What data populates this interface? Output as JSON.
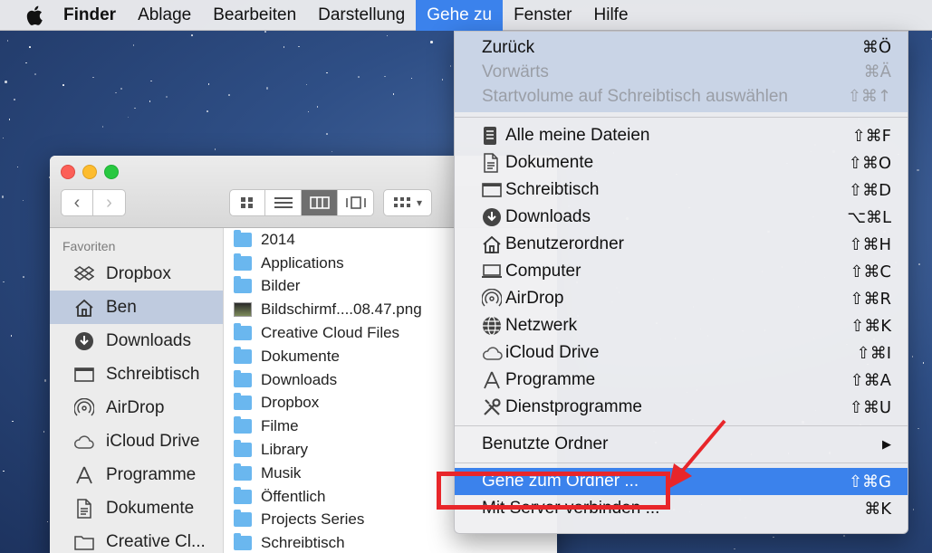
{
  "menubar": {
    "app_name": "Finder",
    "items": [
      "Ablage",
      "Bearbeiten",
      "Darstellung",
      "Gehe zu",
      "Fenster",
      "Hilfe"
    ],
    "active_item": "Gehe zu"
  },
  "finder": {
    "sidebar_heading": "Favoriten",
    "sidebar_items": [
      {
        "label": "Dropbox",
        "icon": "dropbox-icon"
      },
      {
        "label": "Ben",
        "icon": "home-icon",
        "selected": true
      },
      {
        "label": "Downloads",
        "icon": "downloads-icon"
      },
      {
        "label": "Schreibtisch",
        "icon": "desktop-icon"
      },
      {
        "label": "AirDrop",
        "icon": "airdrop-icon"
      },
      {
        "label": "iCloud Drive",
        "icon": "cloud-icon"
      },
      {
        "label": "Programme",
        "icon": "applications-icon"
      },
      {
        "label": "Dokumente",
        "icon": "document-icon"
      },
      {
        "label": "Creative Cl...",
        "icon": "folder-icon"
      }
    ],
    "files": [
      {
        "name": "2014",
        "kind": "folder"
      },
      {
        "name": "Applications",
        "kind": "folder"
      },
      {
        "name": "Bilder",
        "kind": "folder"
      },
      {
        "name": "Bildschirmf....08.47.png",
        "kind": "image"
      },
      {
        "name": "Creative Cloud Files",
        "kind": "folder"
      },
      {
        "name": "Dokumente",
        "kind": "folder"
      },
      {
        "name": "Downloads",
        "kind": "folder"
      },
      {
        "name": "Dropbox",
        "kind": "folder"
      },
      {
        "name": "Filme",
        "kind": "folder"
      },
      {
        "name": "Library",
        "kind": "folder"
      },
      {
        "name": "Musik",
        "kind": "folder"
      },
      {
        "name": "Öffentlich",
        "kind": "folder"
      },
      {
        "name": "Projects Series",
        "kind": "folder"
      },
      {
        "name": "Schreibtisch",
        "kind": "folder"
      }
    ]
  },
  "go_menu": {
    "top_items": [
      {
        "label": "Zurück",
        "shortcut": "⌘Ö",
        "enabled": true
      },
      {
        "label": "Vorwärts",
        "shortcut": "⌘Ä",
        "enabled": false
      },
      {
        "label": "Startvolume auf Schreibtisch auswählen",
        "shortcut": "⇧⌘↑",
        "enabled": false
      }
    ],
    "places": [
      {
        "label": "Alle meine Dateien",
        "shortcut": "⇧⌘F",
        "icon": "all-files-icon"
      },
      {
        "label": "Dokumente",
        "shortcut": "⇧⌘O",
        "icon": "document-icon"
      },
      {
        "label": "Schreibtisch",
        "shortcut": "⇧⌘D",
        "icon": "desktop-icon"
      },
      {
        "label": "Downloads",
        "shortcut": "⌥⌘L",
        "icon": "downloads-icon"
      },
      {
        "label": "Benutzerordner",
        "shortcut": "⇧⌘H",
        "icon": "home-icon"
      },
      {
        "label": "Computer",
        "shortcut": "⇧⌘C",
        "icon": "computer-icon"
      },
      {
        "label": "AirDrop",
        "shortcut": "⇧⌘R",
        "icon": "airdrop-icon"
      },
      {
        "label": "Netzwerk",
        "shortcut": "⇧⌘K",
        "icon": "network-icon"
      },
      {
        "label": "iCloud Drive",
        "shortcut": "⇧⌘I",
        "icon": "cloud-icon"
      },
      {
        "label": "Programme",
        "shortcut": "⇧⌘A",
        "icon": "applications-icon"
      },
      {
        "label": "Dienstprogramme",
        "shortcut": "⇧⌘U",
        "icon": "utilities-icon"
      }
    ],
    "recent": {
      "label": "Benutzte Ordner",
      "submenu_arrow": "▶"
    },
    "goto_folder": {
      "label": "Gehe zum Ordner ...",
      "shortcut": "⇧⌘G"
    },
    "connect_server": {
      "label": "Mit Server verbinden ...",
      "shortcut": "⌘K"
    }
  },
  "colors": {
    "highlight": "#3b82ec",
    "annotation": "#e8262a"
  }
}
